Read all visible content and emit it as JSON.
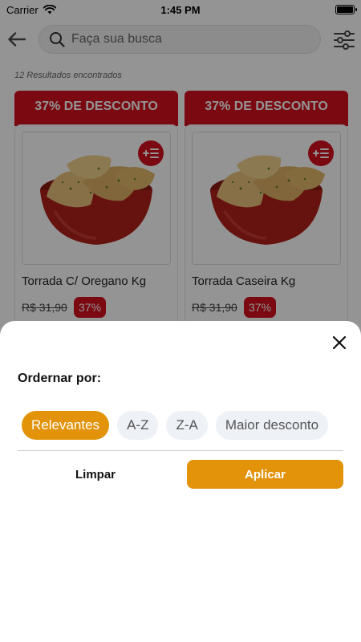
{
  "status_bar": {
    "carrier": "Carrier",
    "time": "1:45 PM"
  },
  "header": {
    "search_placeholder": "Faça sua busca",
    "back_icon": "arrow-left-icon",
    "filter_icon": "sliders-icon"
  },
  "results": {
    "count_text": "12 Resultados encontrados"
  },
  "products": [
    {
      "discount_banner": "37% DE DESCONTO",
      "name": "Torrada C/ Oregano Kg",
      "old_price": "R$ 31,90",
      "discount_badge": "37%"
    },
    {
      "discount_banner": "37% DE DESCONTO",
      "name": "Torrada Caseira Kg",
      "old_price": "R$ 31,90",
      "discount_badge": "37%"
    }
  ],
  "sort_sheet": {
    "title": "Ordernar por:",
    "options": [
      {
        "label": "Relevantes",
        "selected": true
      },
      {
        "label": "A-Z",
        "selected": false
      },
      {
        "label": "Z-A",
        "selected": false
      },
      {
        "label": "Maior desconto",
        "selected": false
      }
    ],
    "clear_label": "Limpar",
    "apply_label": "Aplicar"
  },
  "colors": {
    "brand_red": "#d3101e",
    "accent_orange": "#e2930a",
    "chip_bg": "#eef1f6"
  }
}
